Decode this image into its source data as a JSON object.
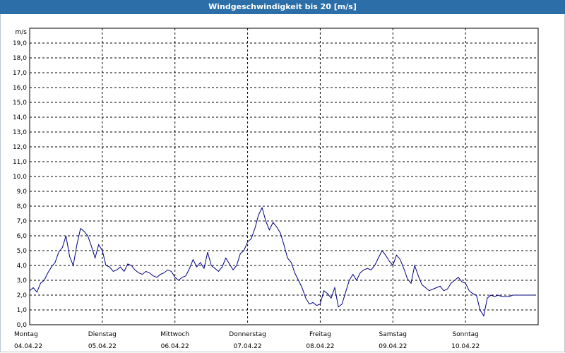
{
  "title": "Windgeschwindigkeit bis 20 [m/s]",
  "colors": {
    "titlebar": "#2b6ea8",
    "line": "#000080",
    "grid": "#000000"
  },
  "chart_data": {
    "type": "line",
    "title": "Windgeschwindigkeit bis 20 [m/s]",
    "ylabel": "m/s",
    "ylim": [
      0,
      20
    ],
    "xlim": [
      0,
      7
    ],
    "grid": true,
    "y_ticks": [
      "0,0",
      "1,0",
      "2,0",
      "3,0",
      "4,0",
      "5,0",
      "6,0",
      "7,0",
      "8,0",
      "9,0",
      "10,0",
      "11,0",
      "12,0",
      "13,0",
      "14,0",
      "15,0",
      "16,0",
      "17,0",
      "18,0",
      "19,0"
    ],
    "x_ticks": [
      {
        "day": "Montag",
        "date": "04.04.22"
      },
      {
        "day": "Dienstag",
        "date": "05.04.22"
      },
      {
        "day": "Mittwoch",
        "date": "06.04.22"
      },
      {
        "day": "Donnerstag",
        "date": "07.04.22"
      },
      {
        "day": "Freitag",
        "date": "08.04.22"
      },
      {
        "day": "Samstag",
        "date": "09.04.22"
      },
      {
        "day": "Sonntag",
        "date": "10.04.22"
      }
    ],
    "series": [
      {
        "x": [
          0,
          0.05,
          0.1,
          0.15,
          0.2,
          0.25,
          0.3,
          0.35,
          0.4,
          0.45,
          0.5,
          0.55,
          0.6,
          0.65,
          0.7,
          0.75,
          0.8,
          0.85,
          0.9,
          0.95,
          1,
          1.05,
          1.1,
          1.15,
          1.2,
          1.25,
          1.3,
          1.35,
          1.4,
          1.45,
          1.5,
          1.55,
          1.6,
          1.65,
          1.7,
          1.75,
          1.8,
          1.85,
          1.9,
          1.95,
          2,
          2.05,
          2.1,
          2.15,
          2.2,
          2.25,
          2.3,
          2.35,
          2.4,
          2.45,
          2.5,
          2.55,
          2.6,
          2.65,
          2.7,
          2.75,
          2.8,
          2.85,
          2.9,
          2.95,
          3,
          3.05,
          3.1,
          3.15,
          3.2,
          3.25,
          3.3,
          3.35,
          3.4,
          3.45,
          3.5,
          3.55,
          3.6,
          3.65,
          3.7,
          3.75,
          3.8,
          3.85,
          3.9,
          3.95,
          4,
          4.05,
          4.1,
          4.15,
          4.2,
          4.25,
          4.3,
          4.35,
          4.4,
          4.45,
          4.5,
          4.55,
          4.6,
          4.65,
          4.7,
          4.75,
          4.8,
          4.85,
          4.9,
          4.95,
          5,
          5.05,
          5.1,
          5.15,
          5.2,
          5.25,
          5.3,
          5.35,
          5.4,
          5.45,
          5.5,
          5.55,
          5.6,
          5.65,
          5.7,
          5.75,
          5.8,
          5.85,
          5.9,
          5.95,
          6,
          6.05,
          6.1,
          6.15,
          6.2,
          6.25,
          6.3,
          6.35,
          6.4,
          6.45,
          6.5,
          6.55,
          6.6,
          6.65,
          6.7,
          6.75,
          6.8,
          6.85,
          6.9,
          6.95
        ],
        "values": [
          2.3,
          2.5,
          2.2,
          2.8,
          3.0,
          3.5,
          3.9,
          4.2,
          4.9,
          5.2,
          6.0,
          4.6,
          4.0,
          5.4,
          6.5,
          6.3,
          6.0,
          5.3,
          4.5,
          5.4,
          5.0,
          4.0,
          3.9,
          3.6,
          3.7,
          3.9,
          3.6,
          4.1,
          4.0,
          3.7,
          3.5,
          3.4,
          3.6,
          3.5,
          3.3,
          3.2,
          3.4,
          3.5,
          3.7,
          3.6,
          3.2,
          3.0,
          3.2,
          3.3,
          3.8,
          4.4,
          3.9,
          4.2,
          3.8,
          4.9,
          4.0,
          3.8,
          3.6,
          3.9,
          4.5,
          4.1,
          3.7,
          4.0,
          4.8,
          5.0,
          5.6,
          5.8,
          6.5,
          7.4,
          7.9,
          7.0,
          6.4,
          6.9,
          6.6,
          6.2,
          5.4,
          4.5,
          4.2,
          3.5,
          3.0,
          2.5,
          1.8,
          1.4,
          1.5,
          1.3,
          1.4,
          2.3,
          2.1,
          1.8,
          2.5,
          1.2,
          1.4,
          2.2,
          3.0,
          3.4,
          3.0,
          3.5,
          3.7,
          3.8,
          3.7,
          4.0,
          4.5,
          5.0,
          4.7,
          4.3,
          4.0,
          4.7,
          4.4,
          3.8,
          3.1,
          2.8,
          4.0,
          3.3,
          2.7,
          2.5,
          2.3,
          2.4,
          2.5,
          2.6,
          2.3,
          2.4,
          2.8,
          3.0,
          3.2,
          2.9,
          2.8,
          2.3,
          2.1,
          2.0,
          1.0,
          0.6,
          1.8,
          2.0,
          1.9,
          2.0,
          1.9,
          1.9,
          1.9,
          2.0,
          2.0,
          2.0,
          2.0,
          2.0,
          2.0,
          2.0
        ]
      }
    ]
  }
}
